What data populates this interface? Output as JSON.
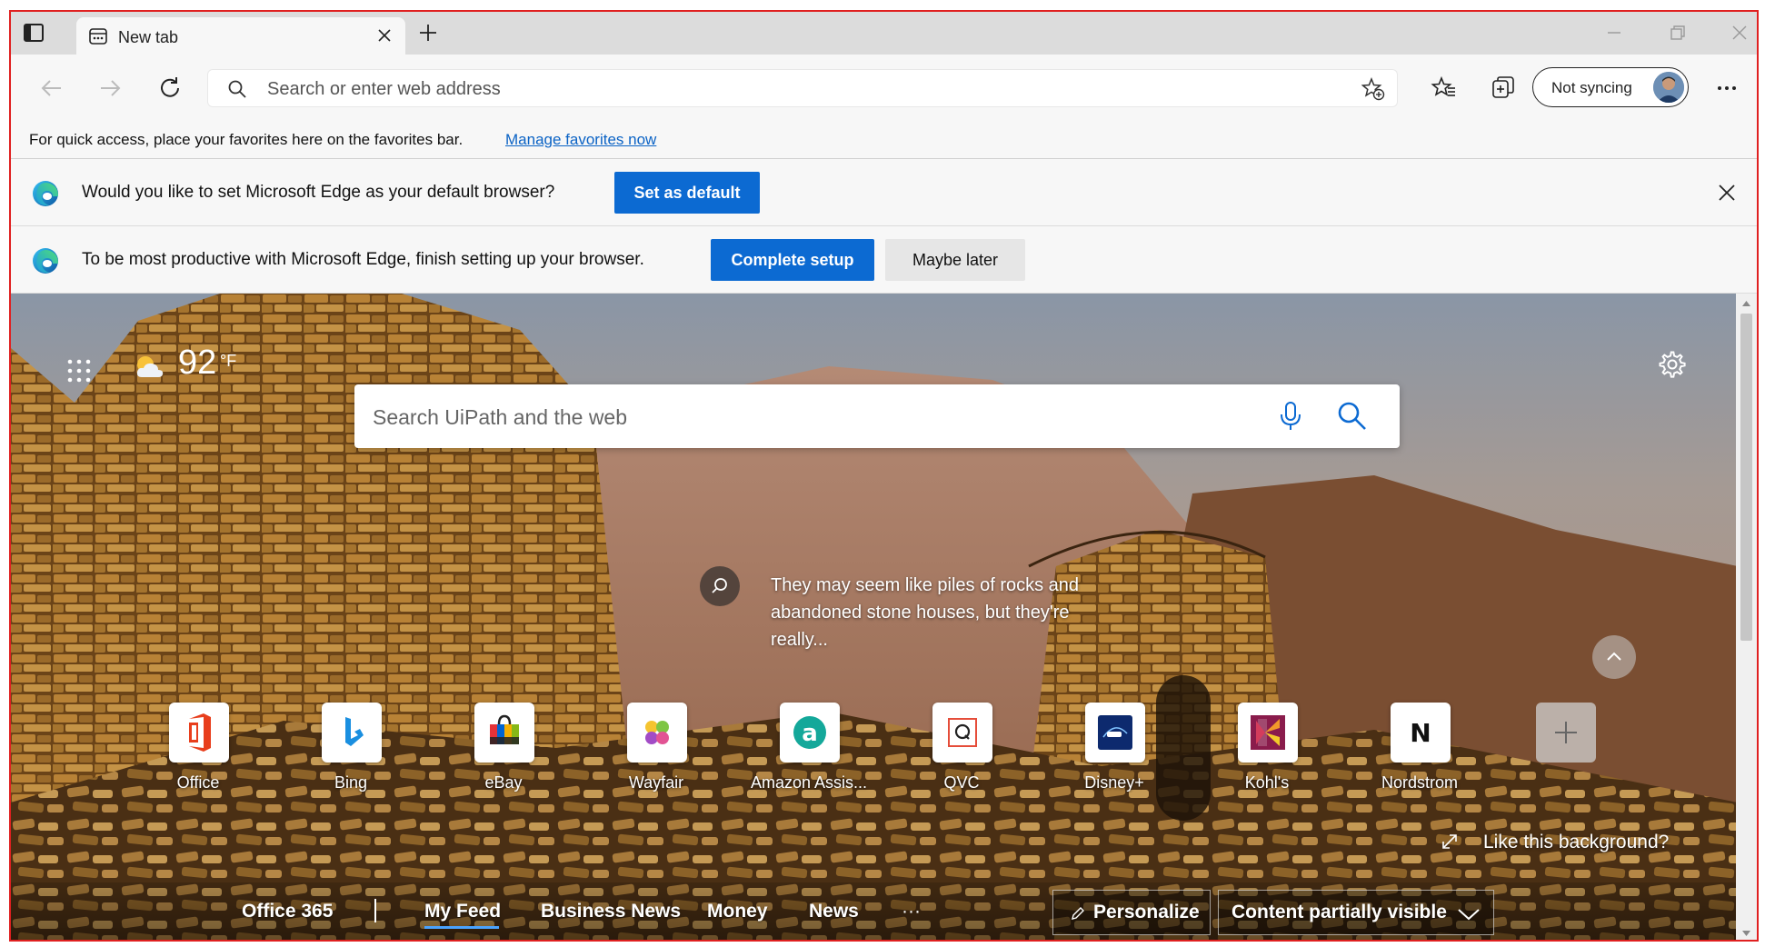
{
  "tabstrip": {
    "tab_title": "New tab",
    "icons": [
      "tab-actions-icon",
      "tab-favicon",
      "close-icon",
      "plus-icon",
      "minimize-icon",
      "restore-icon",
      "close-window-icon"
    ]
  },
  "toolbar": {
    "address_placeholder": "Search or enter web address",
    "sync_label": "Not syncing",
    "icons": [
      "back-arrow-icon",
      "forward-arrow-icon",
      "refresh-icon",
      "search-icon",
      "add-favorite-icon",
      "favorites-icon",
      "collections-icon",
      "more-icon"
    ]
  },
  "favorites_bar": {
    "text": "For quick access, place your favorites here on the favorites bar.",
    "link": "Manage favorites now"
  },
  "default_browser_bar": {
    "text": "Would you like to set Microsoft Edge as your default browser?",
    "button": "Set as default"
  },
  "setup_bar": {
    "text": "To be most productive with Microsoft Edge, finish setting up your browser.",
    "primary_button": "Complete setup",
    "secondary_button": "Maybe later"
  },
  "ntp": {
    "temperature": "92",
    "temperature_unit": "°F",
    "search_placeholder": "Search UiPath and the web",
    "background_caption": "They may seem like piles of rocks and abandoned stone houses, but they're really...",
    "like_background": "Like this background?",
    "tiles": [
      {
        "label": "Office"
      },
      {
        "label": "Bing"
      },
      {
        "label": "eBay"
      },
      {
        "label": "Wayfair"
      },
      {
        "label": "Amazon Assis..."
      },
      {
        "label": "QVC"
      },
      {
        "label": "Disney+"
      },
      {
        "label": "Kohl's"
      },
      {
        "label": "Nordstrom"
      }
    ],
    "feed": {
      "office": "Office 365",
      "my_feed": "My Feed",
      "business_news": "Business News",
      "money": "Money",
      "news": "News",
      "more": "···",
      "personalize": "Personalize",
      "content_visibility": "Content partially visible"
    }
  },
  "colors": {
    "accent": "#0c6ad2",
    "link": "#0b63c5",
    "frame_border": "#e02020"
  }
}
